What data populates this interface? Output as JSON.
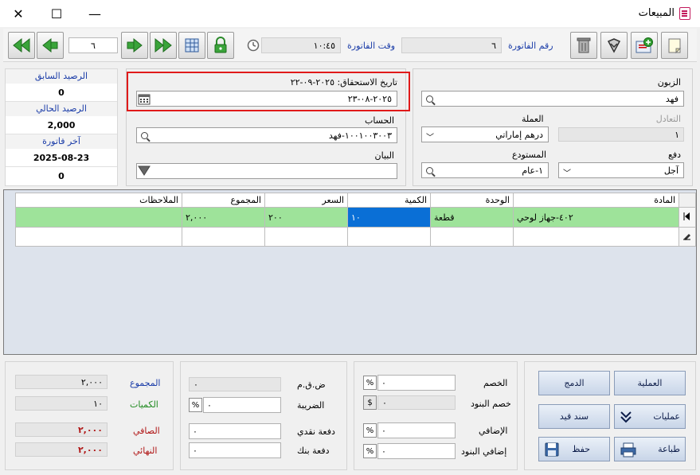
{
  "window": {
    "title": "المبيعات",
    "minimize": "—",
    "maximize": "☐",
    "close": "✕"
  },
  "toolbar": {
    "invoice_number_label": "رقم الفاتورة",
    "invoice_number": "٦",
    "invoice_time_label": "وقت الفاتورة",
    "invoice_time": "١٠:٤٥",
    "nav_value": "٦"
  },
  "form": {
    "customer_label": "الزبون",
    "customer": "فهد",
    "exchange_label": "التعادل",
    "exchange": "١",
    "currency_label": "العملة",
    "currency": "درهم إماراتي",
    "payment_label": "دفع",
    "payment": "آجل",
    "warehouse_label": "المستودع",
    "warehouse": "١-عام",
    "due_date_label": "تاريخ الاستحقاق: ٢٠٢٥-٠٩-٢٢",
    "invoice_date": "٢٠٢٥-٠٨-٢٣",
    "account_label": "الحساب",
    "account": "١٠٠١٠٠٣٠٠٣-فهد",
    "statement_label": "البيان",
    "statement": ""
  },
  "balance": {
    "prev_label": "الرصيد السابق",
    "prev": "0",
    "curr_label": "الرصيد الحالي",
    "curr": "2,000",
    "last_label": "آخر فاتورة",
    "last": "2025-08-23",
    "last_amount": "0"
  },
  "grid": {
    "headers": [
      "المادة",
      "الوحدة",
      "الكمية",
      "السعر",
      "المجموع",
      "الملاحظات"
    ],
    "rows": [
      {
        "item": "٤٠٢-جهاز لوحي",
        "unit": "قطعة",
        "qty": "١٠",
        "price": "٢٠٠",
        "total": "٢,٠٠٠",
        "notes": ""
      }
    ]
  },
  "totals": {
    "total_label": "المجموع",
    "total": "٢,٠٠٠",
    "qty_label": "الكميات",
    "qty": "١٠",
    "net_label": "الصافي",
    "net": "٢,٠٠٠",
    "final_label": "النهائي",
    "final": "٢,٠٠٠"
  },
  "tax": {
    "vat_label": "ض.ق.م",
    "vat": "٠",
    "tax_label": "الضريبة",
    "tax": "٠",
    "cash_label": "دفعة نقدي",
    "cash": "٠",
    "bank_label": "دفعة بنك",
    "bank": "٠"
  },
  "discounts": {
    "discount_label": "الخصم",
    "discount": "٠",
    "item_discount_label": "خصم البنود",
    "item_discount": "٠",
    "extra_label": "الإضافي",
    "extra": "٠",
    "item_extra_label": "إضافي البنود",
    "item_extra": "٠",
    "pct": "%",
    "dollar": "$"
  },
  "actions": {
    "operation": "العملية",
    "merge": "الدمج",
    "operations": "عمليات",
    "voucher": "سند قيد",
    "print": "طباعة",
    "save": "حفظ"
  }
}
